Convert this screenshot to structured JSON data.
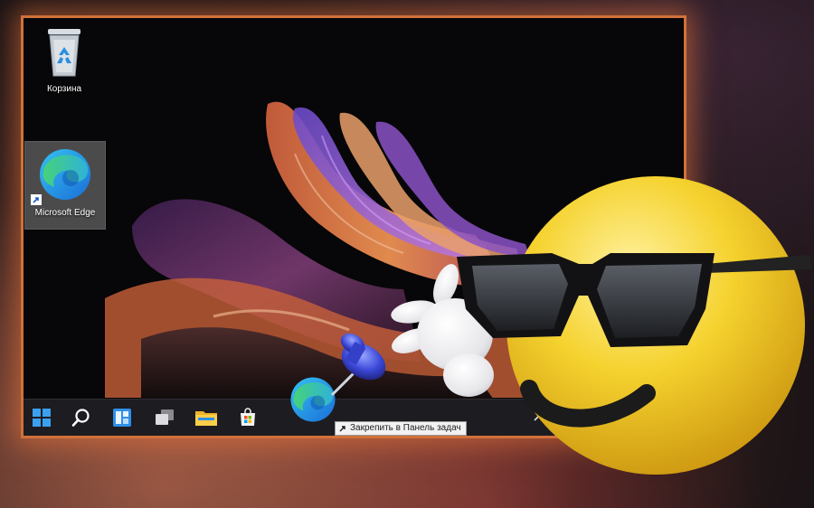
{
  "desktop": {
    "icons": [
      {
        "label": "Корзина",
        "icon": "recycle-bin-icon"
      },
      {
        "label": "Microsoft Edge",
        "icon": "edge-icon",
        "shortcut": true,
        "selected": true
      }
    ]
  },
  "taskbar": {
    "items": [
      {
        "name": "start-button",
        "icon": "windows-logo-icon"
      },
      {
        "name": "search-button",
        "icon": "search-icon"
      },
      {
        "name": "widgets-button",
        "icon": "widgets-icon"
      },
      {
        "name": "task-view-button",
        "icon": "task-view-icon"
      },
      {
        "name": "file-explorer-button",
        "icon": "folder-icon"
      },
      {
        "name": "store-button",
        "icon": "store-icon"
      }
    ],
    "tray": {
      "icon": "chevron-up-icon"
    }
  },
  "drag": {
    "tooltip": "Закрепить в Панель задач",
    "icon": "edge-icon"
  },
  "colors": {
    "screen_glow": "#d0713a",
    "taskbar": "#201e24",
    "accent_blue": "#2f8fe8",
    "smiley_yellow": "#f5d22e"
  }
}
